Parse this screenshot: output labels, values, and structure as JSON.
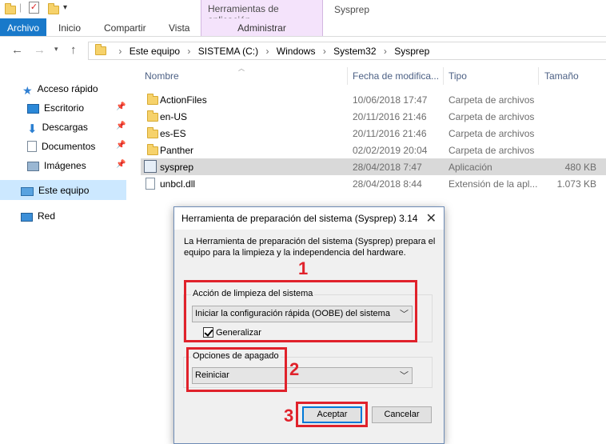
{
  "qat": {
    "context_tab_group": "Herramientas de aplicación",
    "window_title": "Sysprep"
  },
  "ribbon": {
    "tabs": [
      "Archivo",
      "Inicio",
      "Compartir",
      "Vista",
      "Administrar"
    ]
  },
  "address": {
    "crumbs": [
      "Este equipo",
      "SISTEMA (C:)",
      "Windows",
      "System32",
      "Sysprep"
    ]
  },
  "navpane": {
    "quick_access": "Acceso rápido",
    "items": [
      "Escritorio",
      "Descargas",
      "Documentos",
      "Imágenes"
    ],
    "this_pc": "Este equipo",
    "network": "Red"
  },
  "filelist": {
    "columns": [
      "Nombre",
      "Fecha de modifica...",
      "Tipo",
      "Tamaño"
    ],
    "rows": [
      {
        "name": "ActionFiles",
        "date": "10/06/2018 17:47",
        "type": "Carpeta de archivos",
        "size": "",
        "icon": "folder-icon"
      },
      {
        "name": "en-US",
        "date": "20/11/2016 21:46",
        "type": "Carpeta de archivos",
        "size": "",
        "icon": "folder-icon"
      },
      {
        "name": "es-ES",
        "date": "20/11/2016 21:46",
        "type": "Carpeta de archivos",
        "size": "",
        "icon": "folder-icon"
      },
      {
        "name": "Panther",
        "date": "02/02/2019 20:04",
        "type": "Carpeta de archivos",
        "size": "",
        "icon": "folder-icon"
      },
      {
        "name": "sysprep",
        "date": "28/04/2018 7:47",
        "type": "Aplicación",
        "size": "480 KB",
        "icon": "application-icon"
      },
      {
        "name": "unbcl.dll",
        "date": "28/04/2018 8:44",
        "type": "Extensión de la apl...",
        "size": "1.073 KB",
        "icon": "dll-icon"
      }
    ]
  },
  "dialog": {
    "title": "Herramienta de preparación del sistema (Sysprep) 3.14",
    "description": "La Herramienta de preparación del sistema (Sysprep) prepara el equipo para la limpieza y la independencia del hardware.",
    "cleanup_group": "Acción de limpieza del sistema",
    "cleanup_value": "Iniciar la configuración rápida (OOBE) del sistema",
    "generalize_label": "Generalizar",
    "shutdown_group": "Opciones de apagado",
    "shutdown_value": "Reiniciar",
    "ok_label": "Aceptar",
    "cancel_label": "Cancelar"
  },
  "annotations": [
    "1",
    "2",
    "3"
  ],
  "colors": {
    "file_tab": "#1979ca",
    "context_tab": "#f4e3fb",
    "annotation_red": "#e0222b",
    "selected_row": "#d9d9d9",
    "nav_selected": "#cce8ff"
  }
}
